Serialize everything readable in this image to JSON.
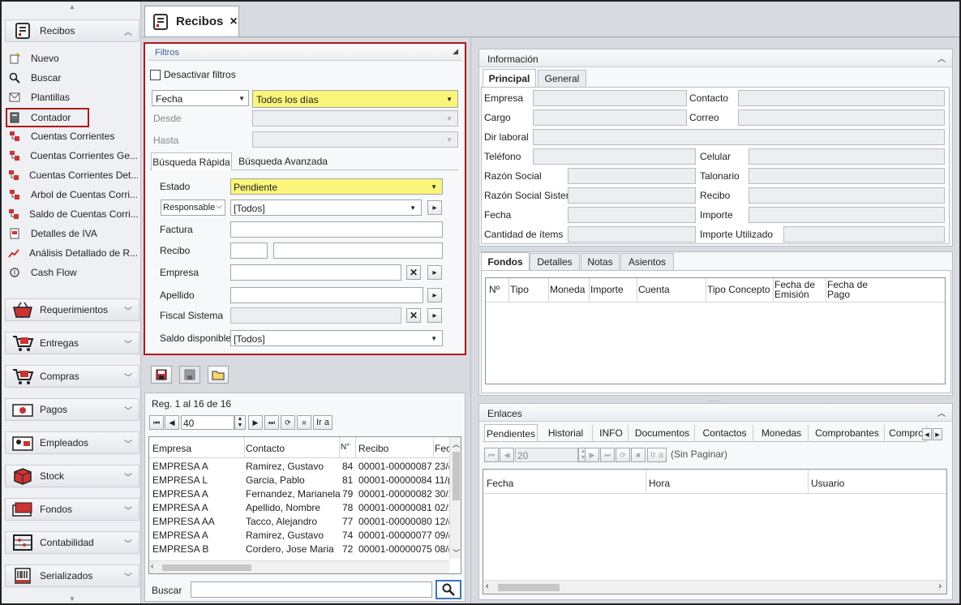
{
  "sidebar": {
    "group_main": {
      "label": "Recibos",
      "icon": "receipt-icon"
    },
    "items": [
      {
        "label": "Nuevo",
        "icon": "new-icon"
      },
      {
        "label": "Buscar",
        "icon": "search-icon"
      },
      {
        "label": "Plantillas",
        "icon": "template-icon"
      },
      {
        "label": "Contador",
        "icon": "calculator-icon"
      },
      {
        "label": "Cuentas Corrientes",
        "icon": "accounts-icon"
      },
      {
        "label": "Cuentas Corrientes Ge...",
        "icon": "accounts-icon"
      },
      {
        "label": "Cuentas Corrientes Det...",
        "icon": "accounts-icon"
      },
      {
        "label": "Arbol de Cuentas Corri...",
        "icon": "accounts-icon"
      },
      {
        "label": "Saldo de Cuentas Corri...",
        "icon": "accounts-icon"
      },
      {
        "label": "Detalles de IVA",
        "icon": "tax-icon"
      },
      {
        "label": "Análisis Detallado de R...",
        "icon": "chart-icon"
      },
      {
        "label": "Cash Flow",
        "icon": "cashflow-icon"
      }
    ],
    "groups": [
      {
        "label": "Requerimientos",
        "icon": "basket-icon"
      },
      {
        "label": "Entregas",
        "icon": "cart-icon"
      },
      {
        "label": "Compras",
        "icon": "cart-icon"
      },
      {
        "label": "Pagos",
        "icon": "payment-icon"
      },
      {
        "label": "Empleados",
        "icon": "employee-icon"
      },
      {
        "label": "Stock",
        "icon": "box-icon"
      },
      {
        "label": "Fondos",
        "icon": "money-icon"
      },
      {
        "label": "Contabilidad",
        "icon": "abacus-icon"
      },
      {
        "label": "Serializados",
        "icon": "barcode-icon"
      }
    ]
  },
  "tab": {
    "title": "Recibos",
    "close": "×"
  },
  "filters": {
    "title": "Filtros",
    "disable_label": "Desactivar filtros",
    "date_field": "Fecha",
    "date_range": "Todos los días",
    "desde_label": "Desde",
    "hasta_label": "Hasta",
    "tabs": [
      "Búsqueda Rápida",
      "Búsqueda Avanzada"
    ],
    "estado_label": "Estado",
    "estado_value": "Pendiente",
    "responsable_select": "Responsable",
    "responsable_value": "[Todos]",
    "factura_label": "Factura",
    "recibo_label": "Recibo",
    "empresa_label": "Empresa",
    "apellido_label": "Apellido",
    "fiscal_label": "Fiscal Sistema",
    "saldo_label": "Saldo disponible",
    "saldo_value": "[Todos]"
  },
  "list": {
    "reg_text": "Reg. 1 al 16 de 16",
    "page_size": "40",
    "go_label": "Ir a",
    "columns": [
      "Empresa",
      "Contacto",
      "N°",
      "Recibo",
      "Fec"
    ],
    "rows": [
      [
        "EMPRESA A",
        "Ramirez, Gustavo",
        "84",
        "00001-00000087",
        "23/("
      ],
      [
        "EMPRESA L",
        "Garcia, Pablo",
        "81",
        "00001-00000084",
        "11/("
      ],
      [
        "EMPRESA A",
        "Fernandez, Marianela",
        "79",
        "00001-00000082",
        "30/1"
      ],
      [
        "EMPRESA A",
        "Apellido, Nombre",
        "78",
        "00001-00000081",
        "02/1"
      ],
      [
        "EMPRESA AA",
        "Tacco, Alejandro",
        "77",
        "00001-00000080",
        "12/("
      ],
      [
        "EMPRESA A",
        "Ramirez, Gustavo",
        "74",
        "00001-00000077",
        "09/("
      ],
      [
        "EMPRESA B",
        "Cordero, Jose Maria",
        "72",
        "00001-00000075",
        "08/("
      ]
    ],
    "search_label": "Buscar"
  },
  "info": {
    "title": "Información",
    "tabs": [
      "Principal",
      "General"
    ],
    "labels": {
      "empresa": "Empresa",
      "contacto": "Contacto",
      "cargo": "Cargo",
      "correo": "Correo",
      "dir": "Dir laboral",
      "telefono": "Teléfono",
      "celular": "Celular",
      "razon": "Razón Social",
      "talonario": "Talonario",
      "razon_sis": "Razón Social Sistema",
      "recibo": "Recibo",
      "fecha": "Fecha",
      "importe": "Importe",
      "cantidad": "Cantidad de ítems",
      "importe_util": "Importe Utilizado"
    }
  },
  "fondos": {
    "tabs": [
      "Fondos",
      "Detalles",
      "Notas",
      "Asientos"
    ],
    "columns": [
      "Nº",
      "Tipo",
      "Moneda",
      "Importe",
      "Cuenta",
      "Tipo Concepto",
      "Fecha de Emisión",
      "Fecha de Pago"
    ]
  },
  "enlaces": {
    "title": "Enlaces",
    "tabs": [
      "Pendientes",
      "Historial",
      "INFO",
      "Documentos",
      "Contactos",
      "Monedas",
      "Comprobantes",
      "Compro"
    ],
    "page_size": "20",
    "go_label": "Ir a",
    "sin_paginar": "(Sin Paginar)",
    "columns": [
      "Fecha",
      "Hora",
      "Usuario"
    ]
  },
  "colors": {
    "highlight": "#b3161b",
    "yellow": "#fbf57a"
  }
}
